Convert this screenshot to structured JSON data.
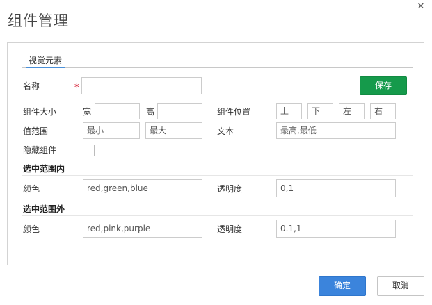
{
  "dialog": {
    "title": "组件管理",
    "close_icon": "close-icon"
  },
  "tabs": [
    {
      "label": "视觉元素",
      "active": true
    }
  ],
  "form": {
    "name_label": "名称",
    "required_mark": "*",
    "name_value": "",
    "save_label": "保存",
    "size_label": "组件大小",
    "width_label": "宽",
    "width_value": "",
    "height_label": "高",
    "height_value": "",
    "position_label": "组件位置",
    "position_top_placeholder": "上",
    "position_bottom_placeholder": "下",
    "position_left_placeholder": "左",
    "position_right_placeholder": "右",
    "range_label": "值范围",
    "range_min_placeholder": "最小",
    "range_max_placeholder": "最大",
    "text_label": "文本",
    "text_placeholder": "最高,最低",
    "hidden_label": "隐藏组件",
    "hidden_checked": false
  },
  "in_range": {
    "title": "选中范围内",
    "color_label": "颜色",
    "color_placeholder": "red,green,blue",
    "opacity_label": "透明度",
    "opacity_placeholder": "0,1"
  },
  "out_range": {
    "title": "选中范围外",
    "color_label": "颜色",
    "color_placeholder": "red,pink,purple",
    "opacity_label": "透明度",
    "opacity_placeholder": "0.1,1"
  },
  "footer": {
    "ok_label": "确定",
    "cancel_label": "取消"
  },
  "colors": {
    "save_button": "#159a4b",
    "ok_button": "#3b84dc",
    "required": "#d0021b",
    "tab_underline": "#4a90d9"
  }
}
